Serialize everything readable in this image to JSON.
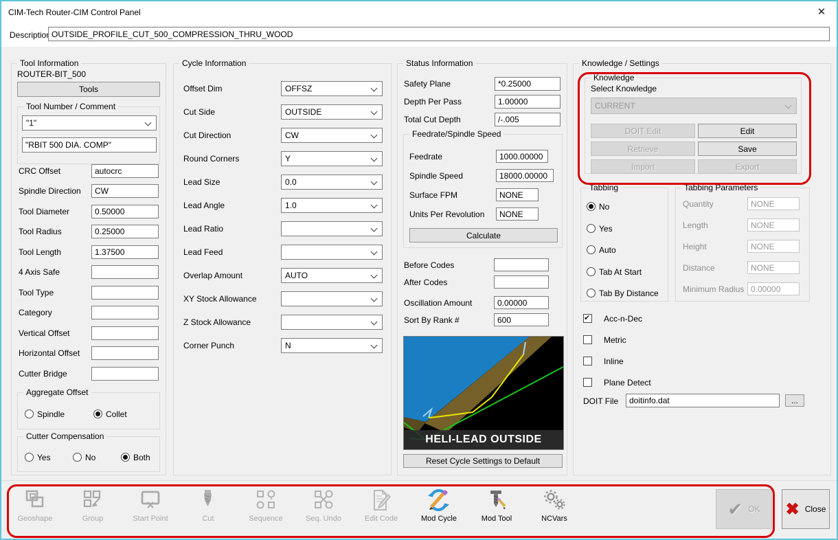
{
  "window": {
    "title": "CIM-Tech Router-CIM Control Panel",
    "close_glyph": "✕"
  },
  "description": {
    "label": "Description",
    "value": "OUTSIDE_PROFILE_CUT_500_COMPRESSION_THRU_WOOD"
  },
  "tool_info": {
    "title": "Tool Information",
    "tool_name": "ROUTER-BIT_500",
    "tools_button": "Tools",
    "tool_number_group": "Tool Number / Comment",
    "tool_number": "\"1\"",
    "tool_comment": "\"RBIT 500 DIA. COMP\"",
    "fields": [
      {
        "label": "CRC Offset",
        "value": "autocrc"
      },
      {
        "label": "Spindle Direction",
        "value": "CW"
      },
      {
        "label": "Tool Diameter",
        "value": "0.50000"
      },
      {
        "label": "Tool Radius",
        "value": "0.25000"
      },
      {
        "label": "Tool Length",
        "value": "1.37500"
      },
      {
        "label": "4 Axis Safe",
        "value": ""
      },
      {
        "label": "Tool Type",
        "value": ""
      },
      {
        "label": "Category",
        "value": ""
      },
      {
        "label": "Vertical Offset",
        "value": ""
      },
      {
        "label": "Horizontal Offset",
        "value": ""
      },
      {
        "label": "Cutter Bridge",
        "value": ""
      }
    ],
    "aggregate_offset": {
      "title": "Aggregate Offset",
      "options": [
        "Spindle",
        "Collet"
      ],
      "selected": "Collet"
    },
    "cutter_compensation": {
      "title": "Cutter Compensation",
      "options": [
        "Yes",
        "No",
        "Both"
      ],
      "selected": "Both"
    }
  },
  "cycle_info": {
    "title": "Cycle Information",
    "fields": [
      {
        "label": "Offset Dim",
        "value": "OFFSZ"
      },
      {
        "label": "Cut Side",
        "value": "OUTSIDE"
      },
      {
        "label": "Cut Direction",
        "value": "CW"
      },
      {
        "label": "Round Corners",
        "value": "Y"
      },
      {
        "label": "Lead Size",
        "value": "0.0"
      },
      {
        "label": "Lead Angle",
        "value": "1.0"
      },
      {
        "label": "Lead Ratio",
        "value": ""
      },
      {
        "label": "Lead Feed",
        "value": ""
      },
      {
        "label": "Overlap Amount",
        "value": "AUTO"
      },
      {
        "label": "XY Stock Allowance",
        "value": ""
      },
      {
        "label": "Z Stock Allowance",
        "value": ""
      },
      {
        "label": "Corner Punch",
        "value": "N"
      }
    ]
  },
  "status_info": {
    "title": "Status Information",
    "fields": [
      {
        "label": "Safety Plane",
        "value": "*0.25000"
      },
      {
        "label": "Depth Per Pass",
        "value": "1.00000"
      },
      {
        "label": "Total Cut Depth",
        "value": "/-.005"
      }
    ],
    "feedrate_group": {
      "title": "Feedrate/Spindle Speed",
      "fields": [
        {
          "label": "Feedrate",
          "value": "1000.00000"
        },
        {
          "label": "Spindle Speed",
          "value": "18000.00000"
        },
        {
          "label": "Surface FPM",
          "value": "NONE"
        },
        {
          "label": "Units Per Revolution",
          "value": "NONE"
        }
      ],
      "calculate_button": "Calculate"
    },
    "fields2": [
      {
        "label": "Before Codes",
        "value": ""
      },
      {
        "label": "After Codes",
        "value": ""
      },
      {
        "label": "Oscillation Amount",
        "value": "0.00000"
      },
      {
        "label": "Sort By Rank #",
        "value": "600"
      }
    ],
    "preview": {
      "caption": "HELI-LEAD OUTSIDE"
    },
    "reset_button": "Reset Cycle Settings to Default"
  },
  "knowledge_settings": {
    "title": "Knowledge / Settings",
    "knowledge": {
      "title": "Knowledge",
      "select_label": "Select Knowledge",
      "selected_value": "CURRENT",
      "buttons": [
        {
          "label": "DOIT Edit",
          "enabled": false
        },
        {
          "label": "Edit",
          "enabled": true
        },
        {
          "label": "Retrieve",
          "enabled": false
        },
        {
          "label": "Save",
          "enabled": true
        },
        {
          "label": "Import",
          "enabled": false
        },
        {
          "label": "Export",
          "enabled": false
        }
      ]
    },
    "tabbing": {
      "title": "Tabbing",
      "options": [
        "No",
        "Yes",
        "Auto",
        "Tab At Start",
        "Tab By Distance"
      ],
      "selected": "No"
    },
    "tabbing_parameters": {
      "title": "Tabbing Parameters",
      "fields": [
        {
          "label": "Quantity",
          "value": "NONE"
        },
        {
          "label": "Length",
          "value": "NONE"
        },
        {
          "label": "Height",
          "value": "NONE"
        },
        {
          "label": "Distance",
          "value": "NONE"
        },
        {
          "label": "Minimum Radius",
          "value": "0.00000"
        }
      ]
    },
    "checkboxes": [
      {
        "label": "Acc-n-Dec",
        "checked": true
      },
      {
        "label": "Metric",
        "checked": false
      },
      {
        "label": "Inline",
        "checked": false
      },
      {
        "label": "Plane Detect",
        "checked": false
      }
    ],
    "doit_file": {
      "label": "DOIT File",
      "value": "doitinfo.dat",
      "browse": "..."
    }
  },
  "toolbar": {
    "items": [
      {
        "label": "Geoshape",
        "enabled": false
      },
      {
        "label": "Group",
        "enabled": false
      },
      {
        "label": "Start Point",
        "enabled": false
      },
      {
        "label": "Cut",
        "enabled": false
      },
      {
        "label": "Sequence",
        "enabled": false
      },
      {
        "label": "Seq. Undo",
        "enabled": false
      },
      {
        "label": "Edit Code",
        "enabled": false
      },
      {
        "label": "Mod Cycle",
        "enabled": true
      },
      {
        "label": "Mod Tool",
        "enabled": true
      },
      {
        "label": "NCVars",
        "enabled": true
      }
    ],
    "ok_button": "OK",
    "ok_check_glyph": "✔",
    "close_button": "Close",
    "close_x_glyph": "✖"
  },
  "colors": {
    "annotation_red": "#d60000",
    "close_x_red": "#cc1111",
    "window_border": "#5fc6d9",
    "preview_blue": "#1b7ec2",
    "preview_green": "#19c619",
    "preview_yellow": "#e6e600"
  }
}
